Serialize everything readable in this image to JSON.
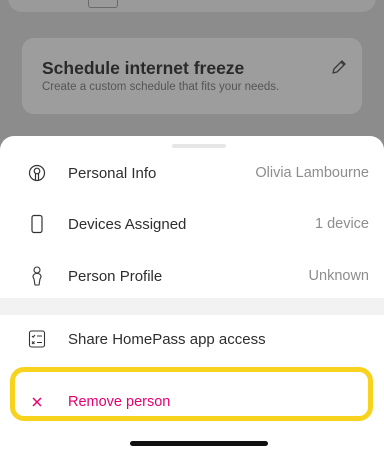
{
  "freeze_card": {
    "title": "Schedule internet freeze",
    "subtitle": "Create a custom schedule that fits your needs."
  },
  "sheet": {
    "rows": [
      {
        "label": "Personal Info",
        "value": "Olivia Lambourne",
        "icon": "person-circle-icon"
      },
      {
        "label": "Devices Assigned",
        "value": "1 device",
        "icon": "phone-icon"
      },
      {
        "label": "Person Profile",
        "value": "Unknown",
        "icon": "person-outline-icon"
      }
    ],
    "share": {
      "label": "Share HomePass app access",
      "icon": "checklist-icon"
    },
    "remove": {
      "label": "Remove person",
      "icon": "close-icon"
    }
  },
  "colors": {
    "accent": "#e6006e",
    "highlight": "#f7d31d"
  }
}
